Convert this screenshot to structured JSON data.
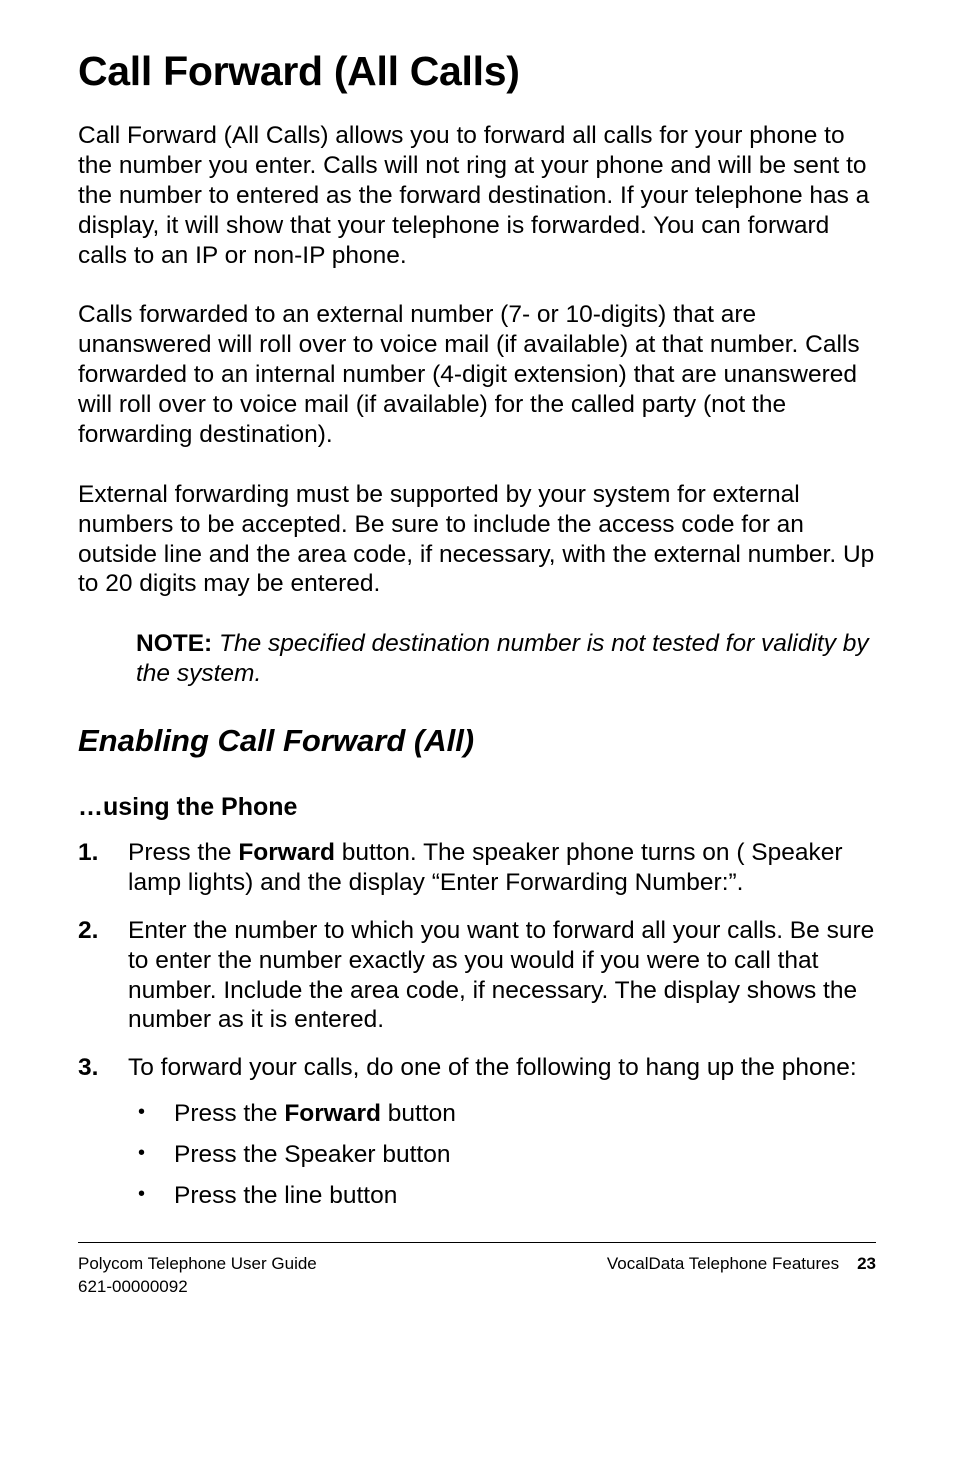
{
  "title": "Call Forward (All Calls)",
  "para1": "Call Forward (All Calls) allows you to forward all calls for your phone to the number you enter. Calls will not ring at your phone and will be sent to the number to entered as the forward destination. If your telephone has a display, it will show that your telephone is forwarded. You can forward calls to an IP or non-IP phone.",
  "para2": "Calls forwarded to an external number (7- or 10-digits) that are unanswered will roll over to voice mail (if available) at that number. Calls forwarded to an internal number (4-digit extension) that are unanswered will roll over to voice mail (if available) for the called party (not the forwarding destination).",
  "para3": "External forwarding must be supported by your system for external numbers to be accepted. Be sure to include the access code for an outside line and the area code, if necessary, with the external number. Up to 20 digits may be entered.",
  "note": {
    "label": "NOTE:",
    "body": " The specified destination number is not tested for validity by the                     system."
  },
  "h2": "Enabling Call Forward (All)",
  "h3": "…using the Phone",
  "steps": [
    {
      "num": "1.",
      "pre": "Press the ",
      "bold": "Forward",
      "post": " button. The speaker phone turns on ( Speaker lamp lights) and the display “Enter Forwarding Number:”."
    },
    {
      "num": "2.",
      "text": "Enter the number to which you want to forward all your calls. Be sure to enter the number exactly as you would if you were to call that number. Include the area code, if necessary. The display shows the number as it is entered."
    },
    {
      "num": "3.",
      "text": "To forward your calls, do one of the following to hang up the phone:",
      "sub": [
        {
          "pre": "Press the ",
          "bold": "Forward",
          "post": " button"
        },
        {
          "text": "Press the Speaker button"
        },
        {
          "text": "Press the  line button"
        }
      ]
    }
  ],
  "footer": {
    "left1": "Polycom Telephone User Guide",
    "left2": "621-00000092",
    "right": "VocalData Telephone Features",
    "page": "23"
  }
}
